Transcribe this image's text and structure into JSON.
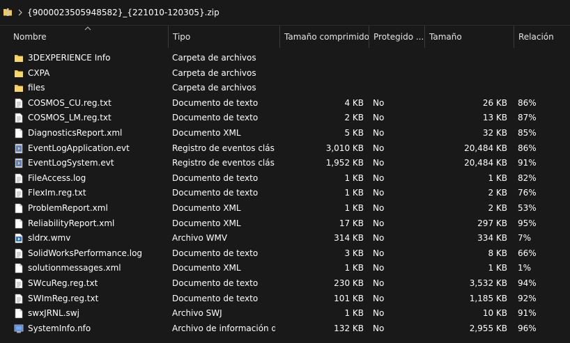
{
  "address_bar": {
    "path": "{9000023505948582}_{221010-120305}.zip",
    "folder_icon": "folder-icon",
    "chevron_icon": "chevron-right-icon"
  },
  "columns": {
    "name": "Nombre",
    "type": "Tipo",
    "compressed_size": "Tamaño comprimido",
    "protected": "Protegido ...",
    "size": "Tamaño",
    "ratio": "Relación"
  },
  "colors": {
    "background": "#191919",
    "folder": "#f2c94c",
    "text": "#ffffff",
    "header_text": "#e4e4e4"
  },
  "files": [
    {
      "name": "3DEXPERIENCE Info",
      "type": "Carpeta de archivos",
      "compressed": "",
      "protected": "",
      "size": "",
      "ratio": "",
      "icon": "folder-icon"
    },
    {
      "name": "CXPA",
      "type": "Carpeta de archivos",
      "compressed": "",
      "protected": "",
      "size": "",
      "ratio": "",
      "icon": "folder-icon"
    },
    {
      "name": "files",
      "type": "Carpeta de archivos",
      "compressed": "",
      "protected": "",
      "size": "",
      "ratio": "",
      "icon": "folder-icon"
    },
    {
      "name": "COSMOS_CU.reg.txt",
      "type": "Documento de texto",
      "compressed": "4 KB",
      "protected": "No",
      "size": "26 KB",
      "ratio": "86%",
      "icon": "text-file-icon"
    },
    {
      "name": "COSMOS_LM.reg.txt",
      "type": "Documento de texto",
      "compressed": "2 KB",
      "protected": "No",
      "size": "13 KB",
      "ratio": "87%",
      "icon": "text-file-icon"
    },
    {
      "name": "DiagnosticsReport.xml",
      "type": "Documento XML",
      "compressed": "5 KB",
      "protected": "No",
      "size": "32 KB",
      "ratio": "85%",
      "icon": "xml-file-icon"
    },
    {
      "name": "EventLogApplication.evt",
      "type": "Registro de eventos clásico",
      "compressed": "3,010 KB",
      "protected": "No",
      "size": "20,484 KB",
      "ratio": "86%",
      "icon": "event-log-icon"
    },
    {
      "name": "EventLogSystem.evt",
      "type": "Registro de eventos clásico",
      "compressed": "1,952 KB",
      "protected": "No",
      "size": "20,484 KB",
      "ratio": "91%",
      "icon": "event-log-icon"
    },
    {
      "name": "FileAccess.log",
      "type": "Documento de texto",
      "compressed": "1 KB",
      "protected": "No",
      "size": "1 KB",
      "ratio": "82%",
      "icon": "text-file-icon"
    },
    {
      "name": "FlexIm.reg.txt",
      "type": "Documento de texto",
      "compressed": "1 KB",
      "protected": "No",
      "size": "2 KB",
      "ratio": "76%",
      "icon": "text-file-icon"
    },
    {
      "name": "ProblemReport.xml",
      "type": "Documento XML",
      "compressed": "1 KB",
      "protected": "No",
      "size": "2 KB",
      "ratio": "53%",
      "icon": "xml-file-icon"
    },
    {
      "name": "ReliabilityReport.xml",
      "type": "Documento XML",
      "compressed": "17 KB",
      "protected": "No",
      "size": "297 KB",
      "ratio": "95%",
      "icon": "xml-file-icon"
    },
    {
      "name": "sldrx.wmv",
      "type": "Archivo WMV",
      "compressed": "314 KB",
      "protected": "No",
      "size": "334 KB",
      "ratio": "7%",
      "icon": "video-file-icon"
    },
    {
      "name": "SolidWorksPerformance.log",
      "type": "Documento de texto",
      "compressed": "3 KB",
      "protected": "No",
      "size": "8 KB",
      "ratio": "66%",
      "icon": "text-file-icon"
    },
    {
      "name": "solutionmessages.xml",
      "type": "Documento XML",
      "compressed": "1 KB",
      "protected": "No",
      "size": "1 KB",
      "ratio": "1%",
      "icon": "xml-file-icon"
    },
    {
      "name": "SWcuReg.reg.txt",
      "type": "Documento de texto",
      "compressed": "230 KB",
      "protected": "No",
      "size": "3,532 KB",
      "ratio": "94%",
      "icon": "text-file-icon"
    },
    {
      "name": "SWImReg.reg.txt",
      "type": "Documento de texto",
      "compressed": "101 KB",
      "protected": "No",
      "size": "1,185 KB",
      "ratio": "92%",
      "icon": "text-file-icon"
    },
    {
      "name": "swxJRNL.swj",
      "type": "Archivo SWJ",
      "compressed": "1 KB",
      "protected": "No",
      "size": "10 KB",
      "ratio": "91%",
      "icon": "generic-file-icon"
    },
    {
      "name": "SystemInfo.nfo",
      "type": "Archivo de información d...",
      "compressed": "132 KB",
      "protected": "No",
      "size": "2,955 KB",
      "ratio": "96%",
      "icon": "system-info-icon"
    }
  ]
}
